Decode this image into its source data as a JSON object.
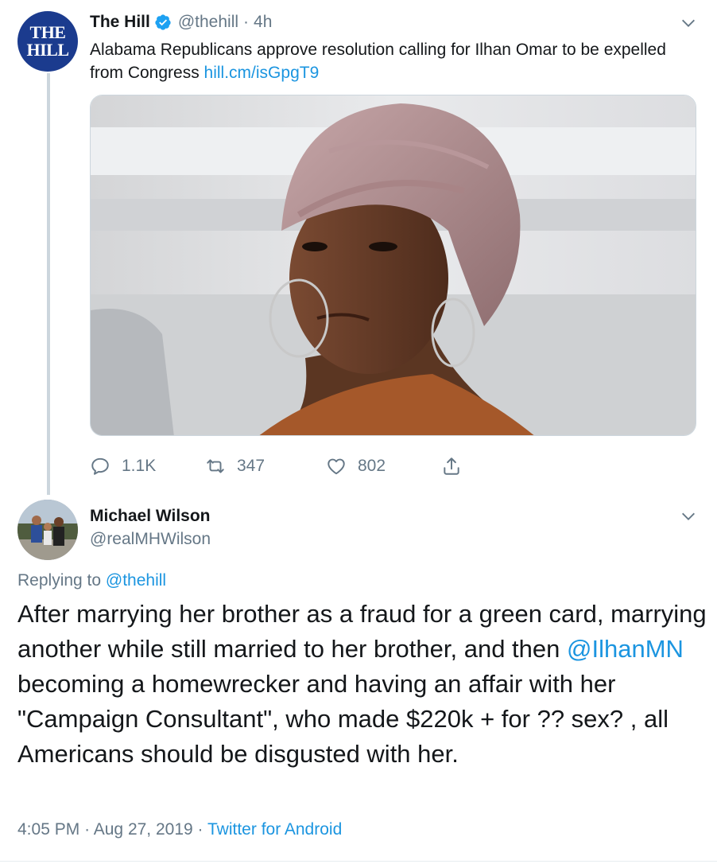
{
  "tweet1": {
    "avatar_lines": [
      "THE",
      "HILL"
    ],
    "name": "The Hill",
    "handle": "@thehill",
    "separator": "·",
    "time": "4h",
    "text": "Alabama Republicans approve resolution calling for Ilhan Omar to be expelled from Congress ",
    "link": "hill.cm/isGpgT9",
    "stats": {
      "replies": "1.1K",
      "retweets": "347",
      "likes": "802"
    }
  },
  "tweet2": {
    "name": "Michael Wilson",
    "handle": "@realMHWilson",
    "replying_prefix": "Replying to ",
    "replying_handle": "@thehill",
    "body_part1": "After marrying her brother as a fraud for a green card, marrying another while still married to her brother, and then ",
    "body_mention": "@IlhanMN",
    "body_part2": " becoming a homewrecker and having an affair with her \"Campaign Consultant\", who made $220k + for ?? sex? , all  Americans should be disgusted with her.",
    "time": "4:05 PM",
    "separator": "·",
    "date": "Aug 27, 2019",
    "source": "Twitter for Android"
  },
  "colors": {
    "link": "#1b95e0",
    "secondary": "#657786",
    "verified": "#1da1f2",
    "thread_line": "#ccd6dd"
  },
  "icons": [
    "verified-badge-icon",
    "chevron-down-icon",
    "reply-icon",
    "retweet-icon",
    "like-icon",
    "share-icon"
  ]
}
